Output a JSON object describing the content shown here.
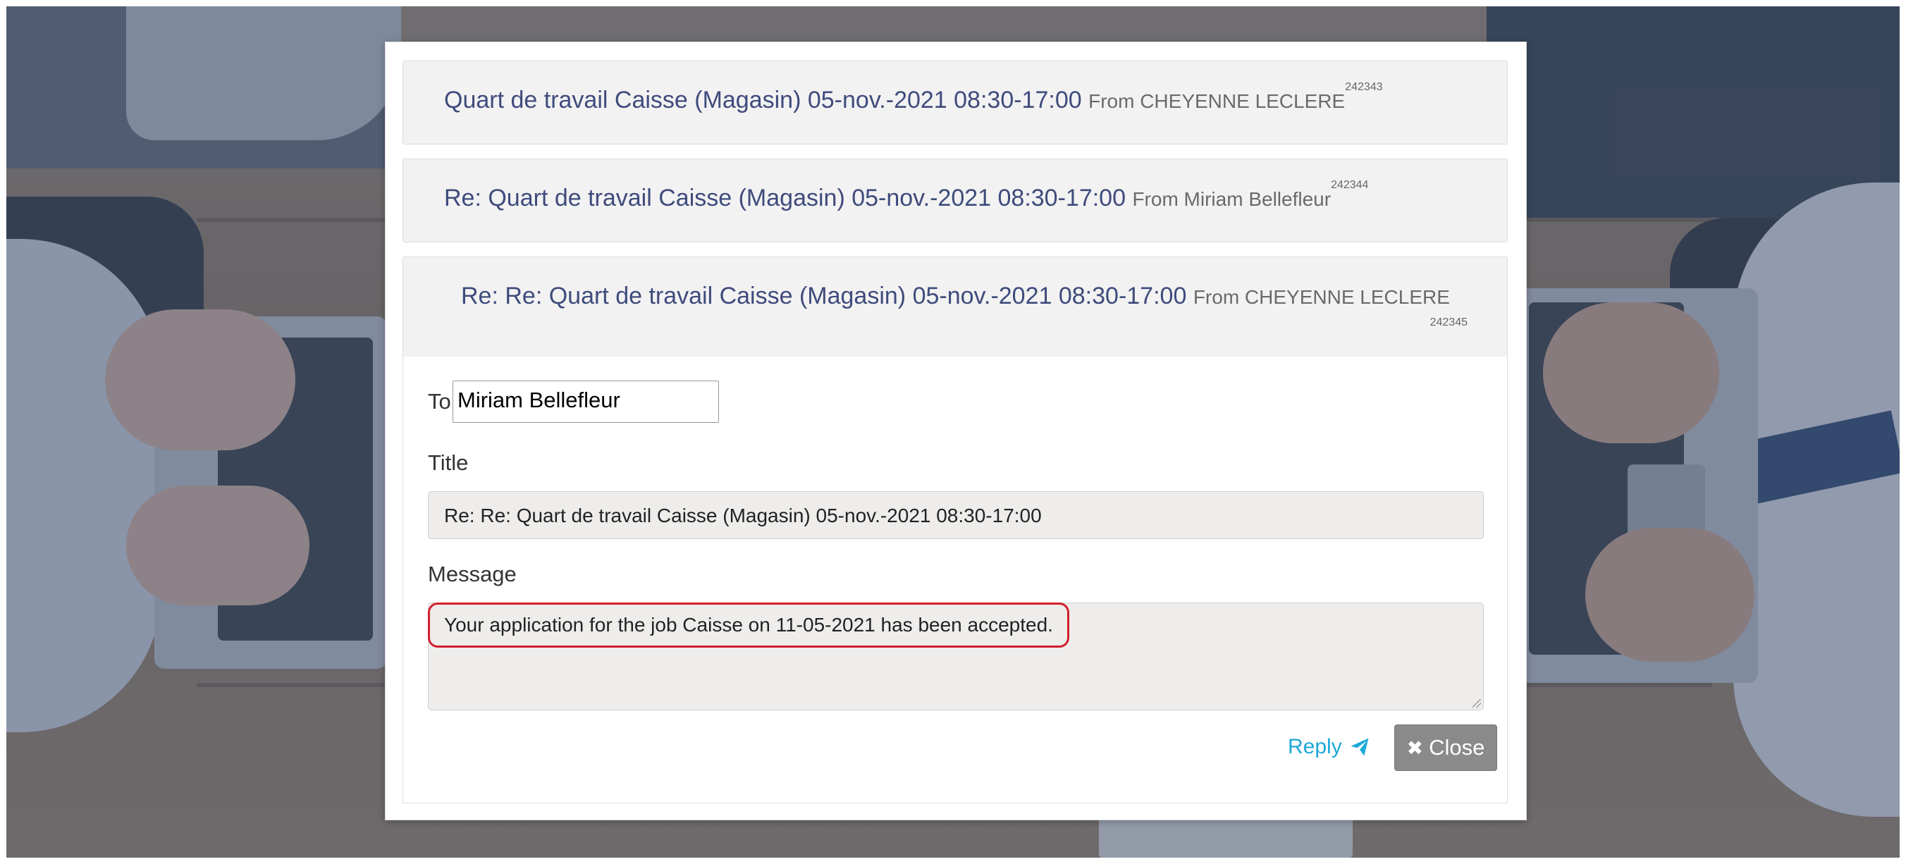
{
  "messages": [
    {
      "subject": "Quart de travail Caisse (Magasin) 05-nov.-2021 08:30-17:00",
      "from_label": "From CHEYENNE LECLERE",
      "id": "242343"
    },
    {
      "subject": "Re: Quart de travail Caisse (Magasin) 05-nov.-2021 08:30-17:00",
      "from_label": "From Miriam Bellefleur",
      "id": "242344"
    },
    {
      "subject": "Re: Re: Quart de travail Caisse (Magasin) 05-nov.-2021 08:30-17:00",
      "from_label": "From CHEYENNE LECLERE",
      "id": "242345"
    }
  ],
  "reply_form": {
    "to_label": "To",
    "to_value": "Miriam Bellefleur",
    "title_label": "Title",
    "title_value": "Re: Re: Quart de travail Caisse (Magasin)  05-nov.-2021 08:30-17:00",
    "message_label": "Message",
    "message_value": "Your application for the job Caisse on 11-05-2021 has been accepted.",
    "reply_label": "Reply",
    "close_label": "Close"
  },
  "icons": {
    "reply": "paper-plane-icon",
    "close": "close-icon"
  },
  "colors": {
    "link": "#1ea9d8",
    "subject": "#3f4b7c",
    "highlight": "#d3202e",
    "close_button": "#8a8a8a"
  }
}
